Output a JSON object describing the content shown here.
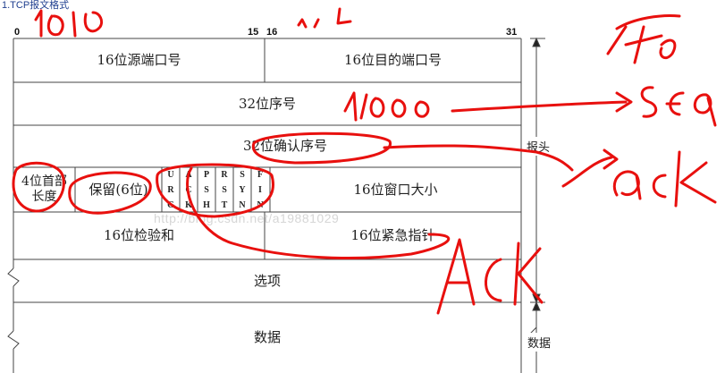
{
  "title": "1.TCP报文格式",
  "bit_labels": {
    "b0": "0",
    "b15": "15",
    "b16": "16",
    "b31": "31"
  },
  "fields": {
    "src_port": "16位源端口号",
    "dst_port": "16位目的端口号",
    "seq": "32位序号",
    "ack": "32位确认序号",
    "header_len_line1": "4位首部",
    "header_len_line2": "长度",
    "reserved": "保留(6位)",
    "window": "16位窗口大小",
    "checksum": "16位检验和",
    "urgent": "16位紧急指针",
    "options": "选项",
    "data": "数据"
  },
  "flags": [
    {
      "top": "U",
      "mid": "R",
      "bot": "G"
    },
    {
      "top": "A",
      "mid": "C",
      "bot": "K"
    },
    {
      "top": "P",
      "mid": "S",
      "bot": "H"
    },
    {
      "top": "R",
      "mid": "S",
      "bot": "T"
    },
    {
      "top": "S",
      "mid": "Y",
      "bot": "N"
    },
    {
      "top": "F",
      "mid": "I",
      "bot": "N"
    }
  ],
  "side_labels": {
    "header": "报头",
    "data": "数据"
  },
  "watermark": "http://blog.csdn.net/a19881029",
  "annotations": {
    "seq_value": "1000",
    "seq_note": "SEQ",
    "ack_note": "ACK",
    "ack_upper_note": "ACK"
  },
  "colors": {
    "annotation_red": "#e8100e",
    "title_blue": "#1f3f8f",
    "line": "#333333"
  }
}
